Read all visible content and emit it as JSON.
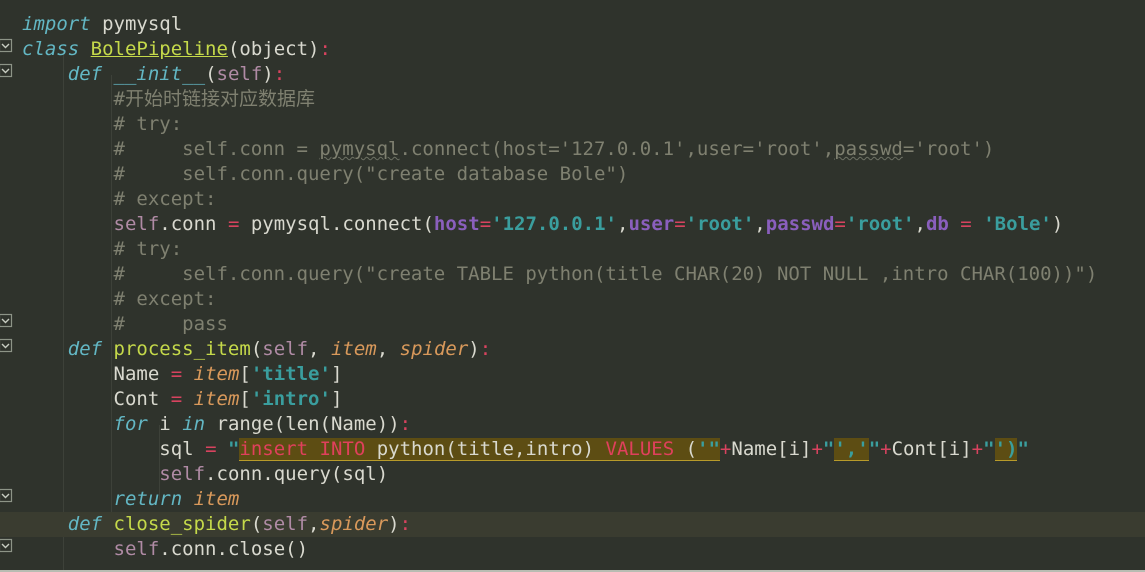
{
  "editor": {
    "theme_name": "dark",
    "background_color": "#2f332c",
    "current_line_color": "#3a3c30",
    "language": "Python",
    "font_size_px": 19,
    "line_height_px": 25,
    "total_visible_lines": 21,
    "current_line_number": 19
  },
  "colors": {
    "keyword": "#63b7c4",
    "class_name": "#c5d94a",
    "function_name": "#c5d94a",
    "self": "#b08ba5",
    "parameter": "#d9995b",
    "operator": "#d8435f",
    "comment": "#7f8070",
    "string": "#3a9e9e",
    "kwarg": "#8a5fbd",
    "default_text": "#d9d9cf",
    "sql_warning_background": "#5d4d13",
    "sql_warning_underline": "#b89b2a",
    "sql_keyword": "#e0405c",
    "indent_guide": "#3d4139"
  },
  "gutter": {
    "fold_icon": "fold-arrow-icon",
    "fold_marker_lines": [
      2,
      3,
      13,
      14,
      18,
      19,
      20
    ]
  },
  "code": {
    "lines": [
      {
        "n": 1,
        "indent": 0,
        "text": "import pymysql"
      },
      {
        "n": 2,
        "indent": 0,
        "text": "class BolePipeline(object):"
      },
      {
        "n": 3,
        "indent": 1,
        "text": "def __init__(self):"
      },
      {
        "n": 4,
        "indent": 2,
        "text": "#开始时链接对应数据库"
      },
      {
        "n": 5,
        "indent": 2,
        "text": "# try:"
      },
      {
        "n": 6,
        "indent": 2,
        "text": "#     self.conn = pymysql.connect(host='127.0.0.1',user='root',passwd='root')"
      },
      {
        "n": 7,
        "indent": 2,
        "text": "#     self.conn.query(\"create database Bole\")"
      },
      {
        "n": 8,
        "indent": 2,
        "text": "# except:"
      },
      {
        "n": 9,
        "indent": 2,
        "text": "self.conn = pymysql.connect(host='127.0.0.1',user='root',passwd='root',db = 'Bole')"
      },
      {
        "n": 10,
        "indent": 2,
        "text": "# try:"
      },
      {
        "n": 11,
        "indent": 2,
        "text": "#     self.conn.query(\"create TABLE python(title CHAR(20) NOT NULL ,intro CHAR(100))\")"
      },
      {
        "n": 12,
        "indent": 2,
        "text": "# except:"
      },
      {
        "n": 13,
        "indent": 2,
        "text": "#     pass"
      },
      {
        "n": 14,
        "indent": 1,
        "text": "def process_item(self, item, spider):"
      },
      {
        "n": 15,
        "indent": 2,
        "text": "Name = item['title']"
      },
      {
        "n": 16,
        "indent": 2,
        "text": "Cont = item['intro']"
      },
      {
        "n": 17,
        "indent": 2,
        "text": "for i in range(len(Name)):"
      },
      {
        "n": 18,
        "indent": 3,
        "text": "sql = \"insert INTO python(title,intro) VALUES ('\"+Name[i]+\"','\"+Cont[i]+\"')\""
      },
      {
        "n": 19,
        "indent": 3,
        "text": "self.conn.query(sql)"
      },
      {
        "n": 20,
        "indent": 2,
        "text": "return item"
      },
      {
        "n": 21,
        "indent": 1,
        "text": "def close_spider(self,spider):"
      },
      {
        "n": 22,
        "indent": 2,
        "text": "self.conn.close()"
      }
    ],
    "identifiers": {
      "module_import": "pymysql",
      "class_name": "BolePipeline",
      "class_base": "object",
      "methods": [
        "__init__",
        "process_item",
        "close_spider"
      ],
      "variables": [
        "self.conn",
        "Name",
        "Cont",
        "sql",
        "i"
      ],
      "item_keys": [
        "title",
        "intro"
      ],
      "db_host": "127.0.0.1",
      "db_user": "root",
      "db_passwd": "root",
      "db_name": "Bole",
      "table_name": "python",
      "chinese_comment": "#开始时链接对应数据库"
    },
    "sql_statement": "insert INTO python(title,intro) VALUES ('...','...')"
  }
}
